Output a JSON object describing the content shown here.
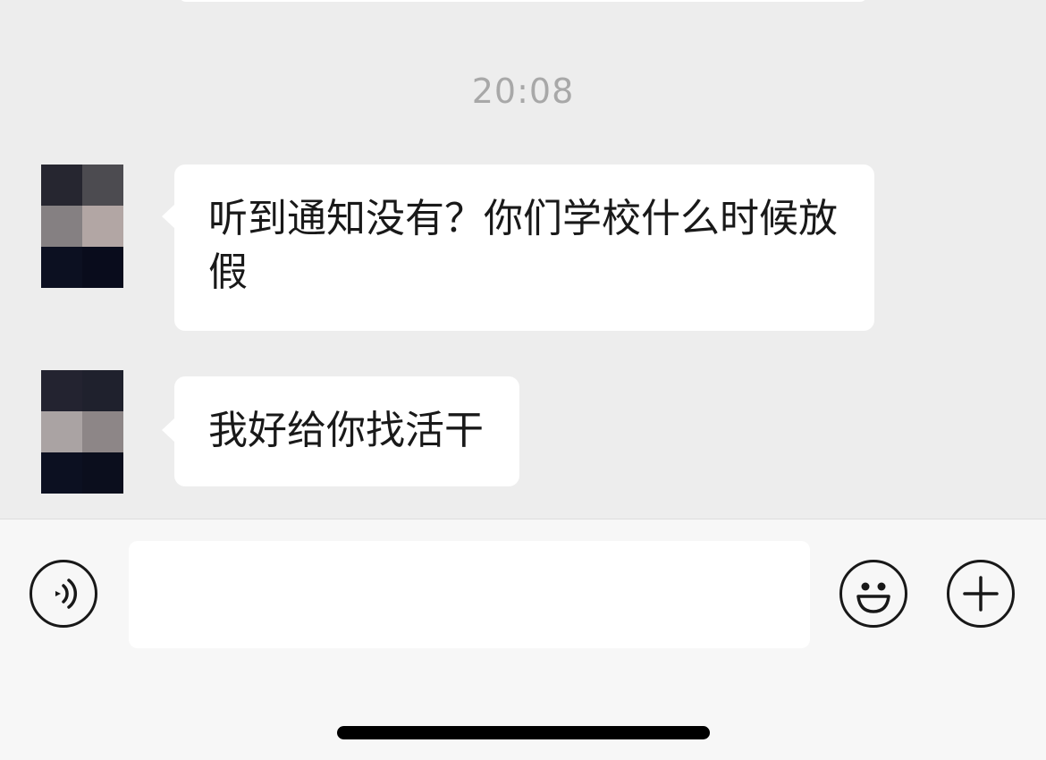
{
  "chat": {
    "timestamp": "20:08",
    "messages": [
      {
        "sender": "contact",
        "text": "听到通知没有？你们学校什么时候放假",
        "avatar_pixels": [
          "#262630",
          "#4c4b50",
          "#858082",
          "#b2a6a4",
          "#0c1021",
          "#090c1c"
        ]
      },
      {
        "sender": "contact",
        "text": "我好给你找活干",
        "avatar_pixels": [
          "#232330",
          "#1f212d",
          "#aaa3a3",
          "#8d8687",
          "#0c1021",
          "#0b0e1d"
        ]
      }
    ]
  },
  "input_bar": {
    "message_input_value": "",
    "voice_icon": "voice-icon",
    "emoji_icon": "emoji-icon",
    "more_icon": "plus-icon"
  },
  "colors": {
    "chat_background": "#ededed",
    "bubble_background": "#ffffff",
    "timestamp_text": "#a8a8a8",
    "input_bar_background": "#f7f7f7"
  }
}
